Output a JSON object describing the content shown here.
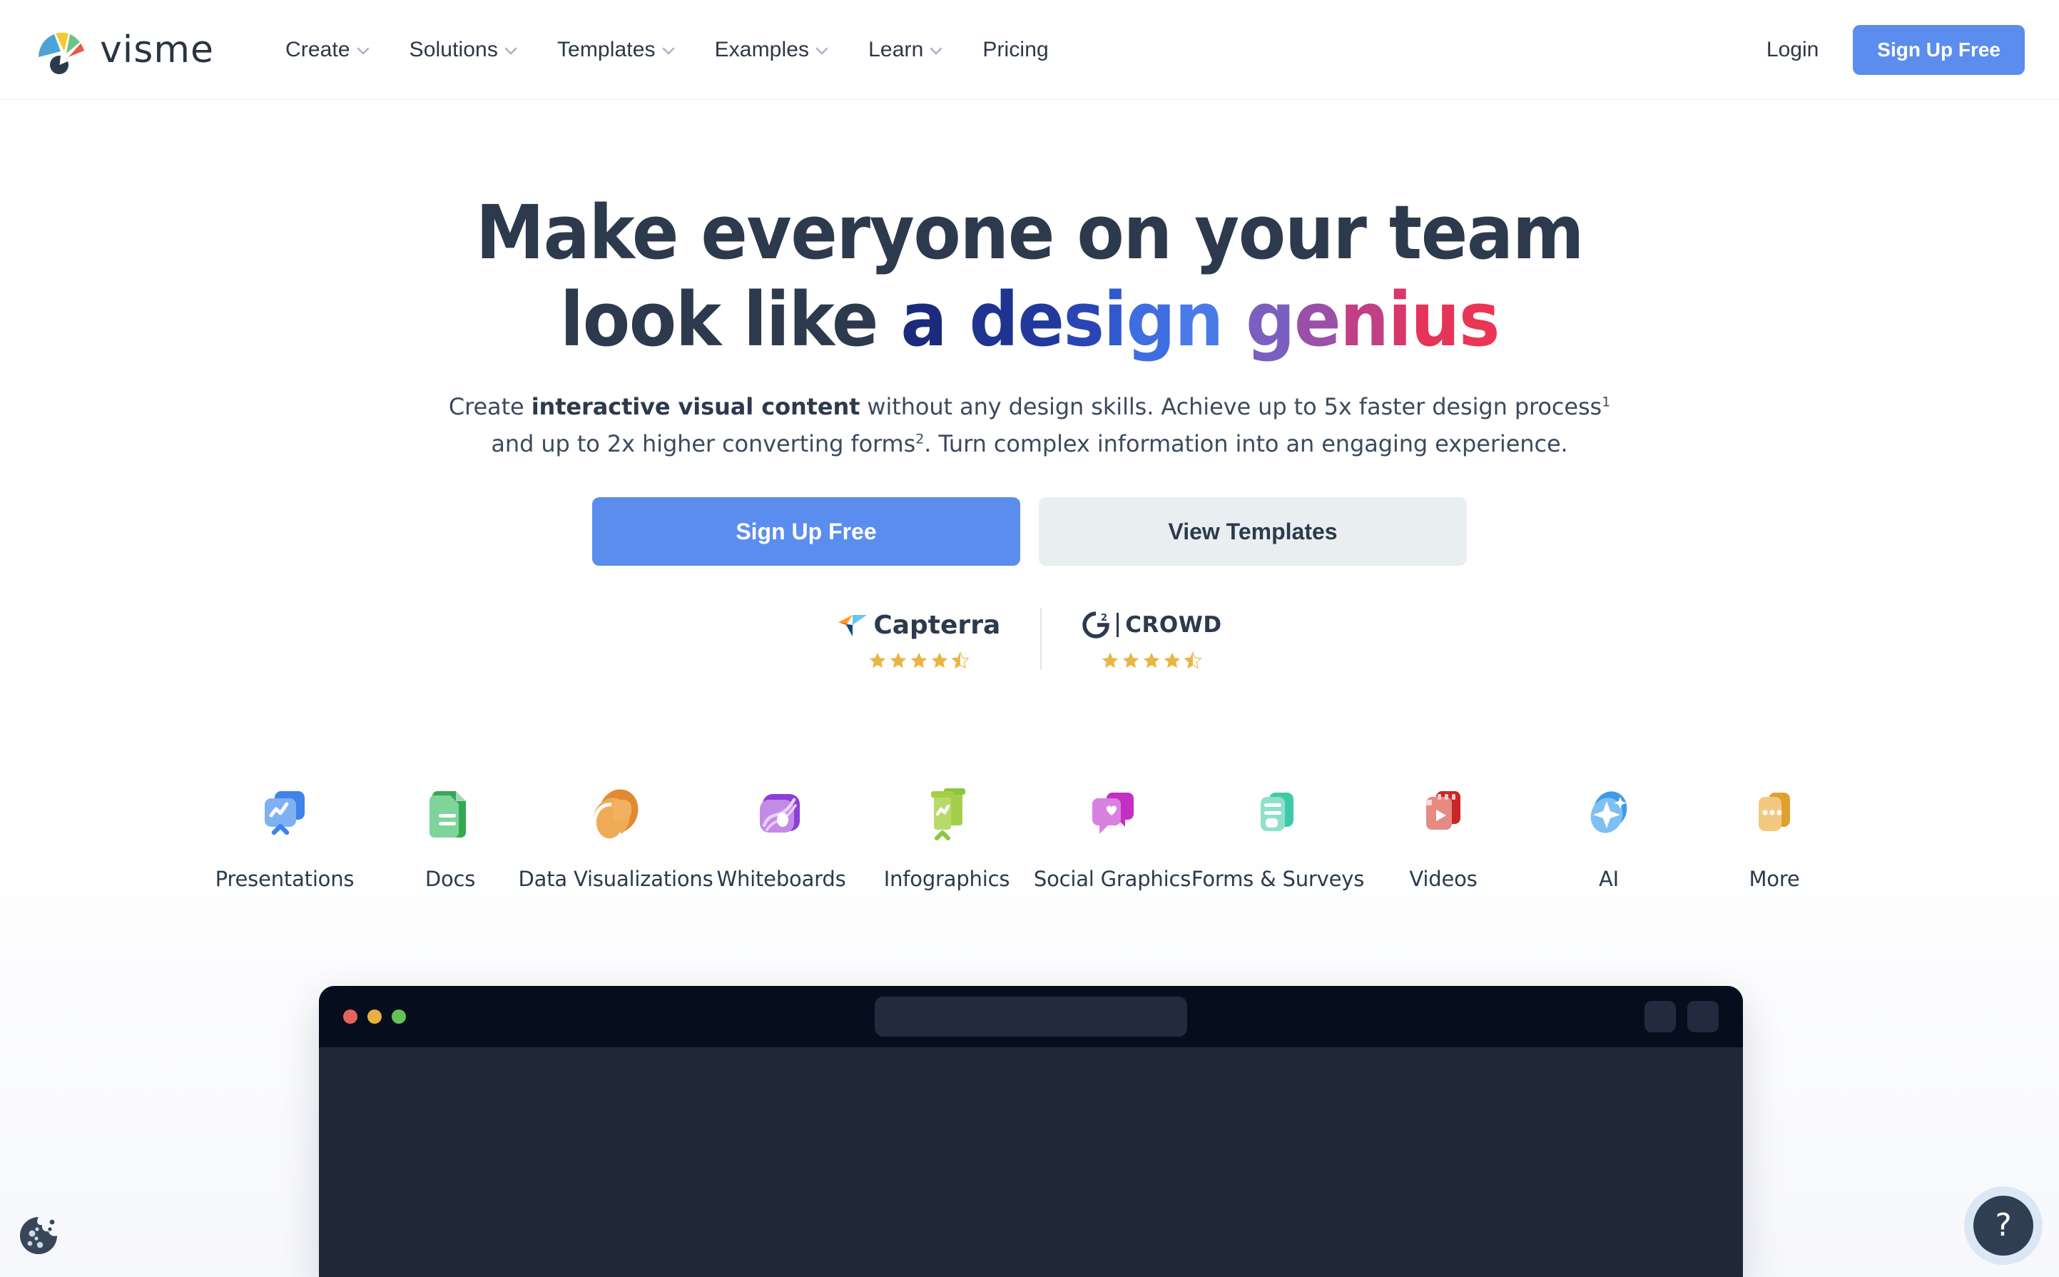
{
  "brand": {
    "name": "visme",
    "logo_colors": {
      "blue": "#4da3d6",
      "yellow": "#f2cb30",
      "green": "#6ec28a",
      "red": "#e8594a",
      "eye": "#2d3a4d"
    }
  },
  "nav": {
    "items": [
      {
        "label": "Create",
        "has_dropdown": true
      },
      {
        "label": "Solutions",
        "has_dropdown": true
      },
      {
        "label": "Templates",
        "has_dropdown": true
      },
      {
        "label": "Examples",
        "has_dropdown": true
      },
      {
        "label": "Learn",
        "has_dropdown": true
      },
      {
        "label": "Pricing",
        "has_dropdown": false
      }
    ],
    "login_label": "Login",
    "signup_label": "Sign Up Free"
  },
  "hero": {
    "headline_line1": "Make everyone on your team",
    "headline_line2_plain": "look like ",
    "headline_line2_gradient": "a design genius",
    "subhead_line1_pre": "Create ",
    "subhead_line1_bold": "interactive visual content",
    "subhead_line1_post": " without any design skills. Achieve up to 5x faster design process",
    "subhead_sup1": "1",
    "subhead_line2_pre": "and up to 2x higher converting forms",
    "subhead_sup2": "2",
    "subhead_line2_post": ". Turn complex information into an engaging experience.",
    "cta_primary": "Sign Up Free",
    "cta_secondary": "View Templates"
  },
  "badges": [
    {
      "name": "Capterra",
      "rating": 4.5,
      "stars_full": 4,
      "stars_half": 1
    },
    {
      "name": "G2 CROWD",
      "rating": 4.5,
      "stars_full": 4,
      "stars_half": 1
    }
  ],
  "categories": [
    {
      "label": "Presentations",
      "icon": "presentation-icon",
      "color": "#3f83e8"
    },
    {
      "label": "Docs",
      "icon": "document-icon",
      "color": "#35a853"
    },
    {
      "label": "Data Visualizations",
      "icon": "pie-chart-icon",
      "color": "#e08b33"
    },
    {
      "label": "Whiteboards",
      "icon": "whiteboard-icon",
      "color": "#8b3fd8"
    },
    {
      "label": "Infographics",
      "icon": "infographic-icon",
      "color": "#8cc63f"
    },
    {
      "label": "Social Graphics",
      "icon": "chat-heart-icon",
      "color": "#c42ec4"
    },
    {
      "label": "Forms & Surveys",
      "icon": "form-icon",
      "color": "#3fc9a8"
    },
    {
      "label": "Videos",
      "icon": "video-icon",
      "color": "#d93030"
    },
    {
      "label": "AI",
      "icon": "sparkle-icon",
      "color": "#3f9ae8"
    },
    {
      "label": "More",
      "icon": "more-cards-icon",
      "color": "#e0a030"
    }
  ],
  "mockup": {
    "window_dots": [
      "red",
      "yellow",
      "green"
    ],
    "titlebar_color": "#060d1d",
    "body_color": "#1e2836"
  },
  "widgets": {
    "cookie_icon": "cookie-icon",
    "help_label": "?"
  },
  "colors": {
    "accent_blue": "#5b8def",
    "text_dark": "#2d3a4d",
    "star_gold": "#eab543"
  }
}
